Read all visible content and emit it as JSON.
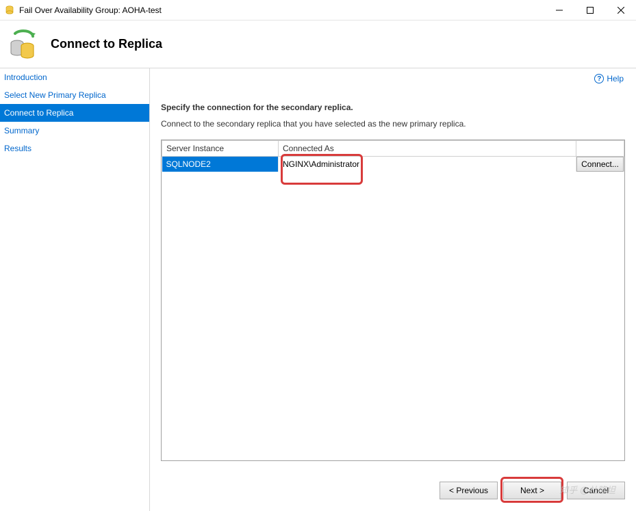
{
  "window": {
    "title": "Fail Over Availability Group: AOHA-test"
  },
  "header": {
    "title": "Connect to Replica"
  },
  "sidebar": {
    "items": [
      {
        "label": "Introduction"
      },
      {
        "label": "Select New Primary Replica"
      },
      {
        "label": "Connect to Replica"
      },
      {
        "label": "Summary"
      },
      {
        "label": "Results"
      }
    ]
  },
  "help": {
    "label": "Help"
  },
  "main": {
    "instruction_bold": "Specify the connection for the secondary replica.",
    "instruction": "Connect to the secondary replica that you have selected as the new primary replica.",
    "columns": {
      "server_instance": "Server Instance",
      "connected_as": "Connected As"
    },
    "rows": [
      {
        "server": "SQLNODE2",
        "connected_as": "NGINX\\Administrator",
        "button": "Connect..."
      }
    ]
  },
  "footer": {
    "previous": "< Previous",
    "next": "Next >",
    "cancel": "Cancel"
  },
  "watermark": "知乎 @杜隆坦"
}
